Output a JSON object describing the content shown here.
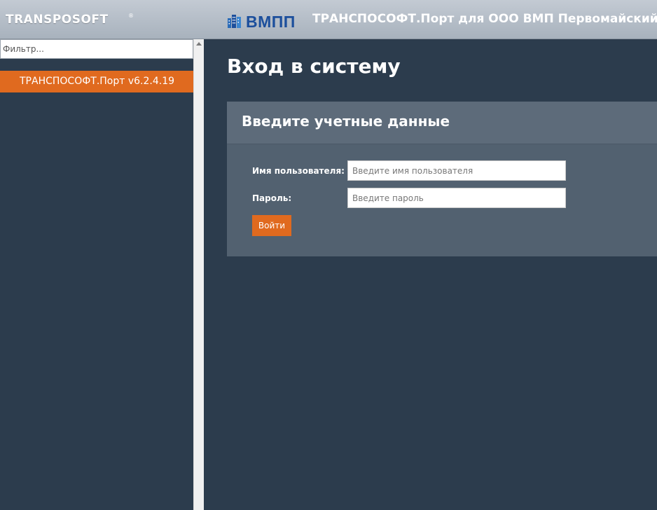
{
  "header": {
    "brand": "TRANSPOSOFT",
    "brand_mark": "®",
    "logo_text": "ВМПП",
    "title": "ТРАНСПОСОФТ.Порт для ООО ВМП Первомайский"
  },
  "sidebar": {
    "filter_placeholder": "Фильтр...",
    "items": [
      {
        "label": "ТРАНСПОСОФТ.Порт v6.2.4.19"
      }
    ]
  },
  "main": {
    "page_title": "Вход в систему",
    "panel": {
      "title": "Введите учетные данные",
      "username_label": "Имя пользователя:",
      "username_placeholder": "Введите имя пользователя",
      "username_value": "",
      "password_label": "Пароль:",
      "password_placeholder": "Введите пароль",
      "password_value": "",
      "submit_label": "Войти"
    }
  },
  "icons": {
    "logo": "building-logo-icon",
    "scroll": "scroll-up-arrow-icon"
  },
  "colors": {
    "accent": "#e06a1f",
    "background": "#2c3c4d",
    "panel": "#526170",
    "panel_header": "#5d6b7a",
    "logo_blue": "#1c4f9c"
  }
}
